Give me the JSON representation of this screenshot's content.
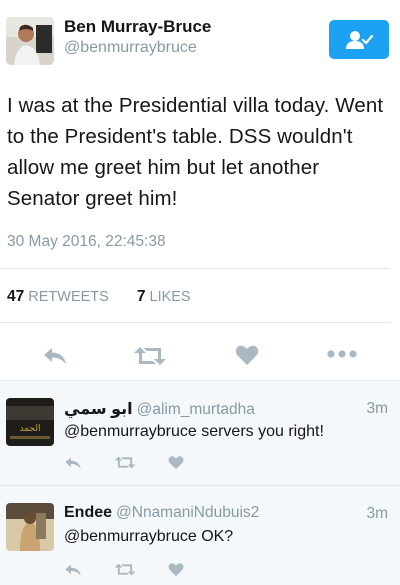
{
  "tweet": {
    "author_name": "Ben Murray-Bruce",
    "author_handle": "@benmurraybruce",
    "text": "I was at the Presidential villa today. Went to the President's table. DSS wouldn't allow me greet him but let another Senator greet him!",
    "timestamp": "30 May 2016, 22:45:38",
    "retweets_count": "47",
    "retweets_label": "RETWEETS",
    "likes_count": "7",
    "likes_label": "LIKES"
  },
  "replies": [
    {
      "name": "ابو سمي",
      "handle": "@alim_murtadha",
      "time": "3m",
      "text": "@benmurraybruce servers you right!"
    },
    {
      "name": "Endee",
      "handle": "@NnamaniNdubuis2",
      "time": "3m",
      "text": "@benmurraybruce OK?"
    }
  ],
  "colors": {
    "accent": "#1da1f2",
    "secondary_text": "#8899a6",
    "icon": "#aab8c2",
    "reply_bg": "#f5f8fa"
  },
  "icons": [
    "follow-person-icon",
    "reply-icon",
    "retweet-icon",
    "like-heart-icon",
    "more-dots-icon"
  ]
}
